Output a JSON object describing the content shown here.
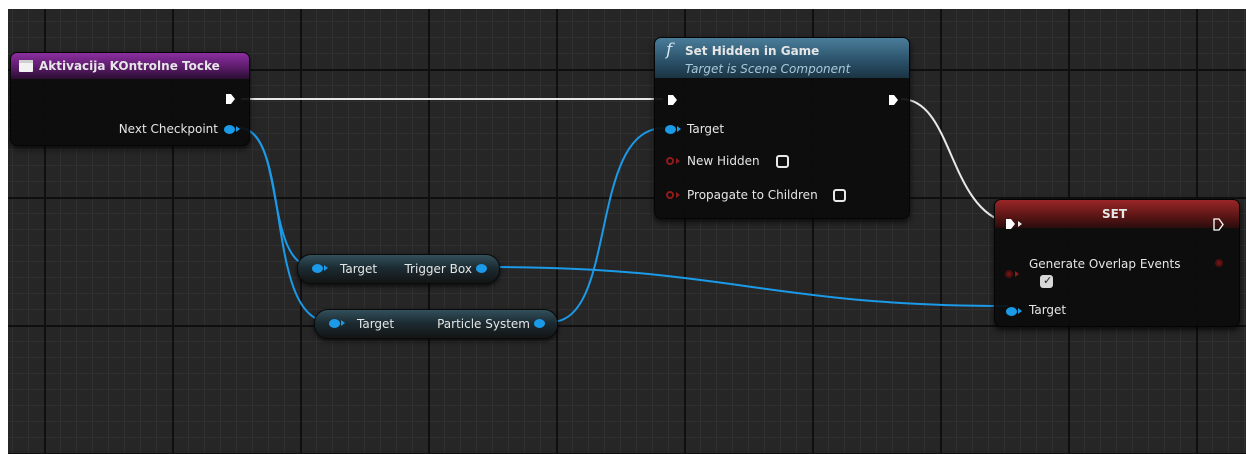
{
  "event_node": {
    "title": "Aktivacija KOntrolne Tocke",
    "icon": "event-icon",
    "output_pin": "Next Checkpoint"
  },
  "getter_trigger": {
    "input_pin": "Target",
    "output_pin": "Trigger Box"
  },
  "getter_particle": {
    "input_pin": "Target",
    "output_pin": "Particle System"
  },
  "set_hidden_node": {
    "icon": "f",
    "title": "Set Hidden in Game",
    "subtitle": "Target is Scene Component",
    "pins": {
      "target": "Target",
      "new_hidden": "New Hidden",
      "propagate": "Propagate to Children"
    },
    "new_hidden_checked": false,
    "propagate_checked": false
  },
  "set_node": {
    "title": "SET",
    "pins": {
      "generate_overlap": "Generate Overlap Events",
      "target": "Target"
    },
    "generate_overlap_checked": true
  },
  "colors": {
    "canvas": "#262626",
    "exec_wire": "#e8e8e8",
    "object_pin": "#1b9ae8",
    "bool_pin": "#8f1b1b",
    "event_header": "#8c2fa0",
    "function_header": "#4a7d9a",
    "set_header": "#9a2727"
  }
}
